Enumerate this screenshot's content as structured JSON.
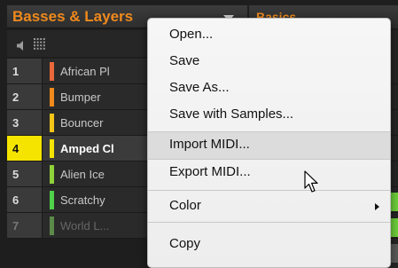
{
  "group": {
    "title": "Basses & Layers"
  },
  "right_panel": {
    "title": "Basics"
  },
  "icons": {
    "speaker": "speaker-icon",
    "grid": "grid-icon",
    "dropdown": "triangle-down-icon",
    "submenu": "triangle-right-icon",
    "cursor": "mouse-pointer-icon"
  },
  "sounds": [
    {
      "slot": "1",
      "name": "African Pl",
      "color": "#e9683a"
    },
    {
      "slot": "2",
      "name": "Bumper",
      "color": "#f08a1c"
    },
    {
      "slot": "3",
      "name": "Bouncer",
      "color": "#f5c518"
    },
    {
      "slot": "4",
      "name": "Amped Cl",
      "color": "#f5e400",
      "selected": true
    },
    {
      "slot": "5",
      "name": "Alien Ice",
      "color": "#8fd13a"
    },
    {
      "slot": "6",
      "name": "Scratchy",
      "color": "#4fd14a"
    },
    {
      "slot": "7",
      "name": "World L...",
      "color": "#5b8a4a",
      "dim": true
    }
  ],
  "context_menu": {
    "items": [
      {
        "label": "Open..."
      },
      {
        "label": "Save"
      },
      {
        "label": "Save As..."
      },
      {
        "label": "Save with Samples..."
      },
      {
        "label": "Import MIDI...",
        "hovered": true
      },
      {
        "label": "Export MIDI..."
      },
      {
        "label": "Color",
        "submenu": true
      },
      {
        "label": "Copy"
      }
    ]
  },
  "colors": {
    "accent_orange": "#f08a1c",
    "selected_yellow": "#f5e400",
    "menu_bg": "#f2f2f2",
    "menu_hover": "#dcdcdc"
  }
}
